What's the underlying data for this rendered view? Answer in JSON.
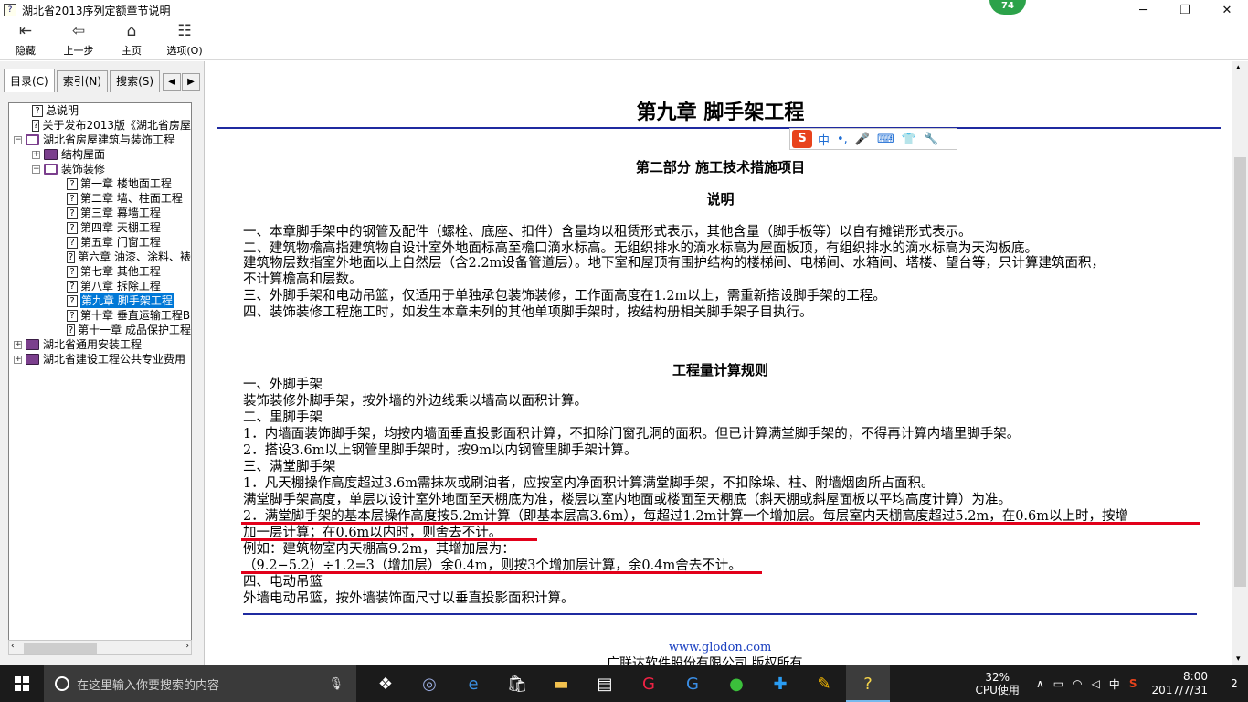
{
  "window": {
    "title": "湖北省2013序列定额章节说明",
    "controls": {
      "minimize": "─",
      "maximize": "❐",
      "close": "✕"
    },
    "badge": "74"
  },
  "toolbar": {
    "hide": "隐藏",
    "back": "上一步",
    "home": "主页",
    "options": "选项(O)"
  },
  "nav_tabs": {
    "contents": "目录(C)",
    "index": "索引(N)",
    "search": "搜索(S)"
  },
  "tree": [
    {
      "label": "总说明",
      "type": "doc",
      "level": 1
    },
    {
      "label": "关于发布2013版《湖北省房屋",
      "type": "doc",
      "level": 1
    },
    {
      "label": "湖北省房屋建筑与装饰工程",
      "type": "book-open",
      "level": 0,
      "expander": "−"
    },
    {
      "label": "结构屋面",
      "type": "book",
      "level": 1,
      "expander": "+"
    },
    {
      "label": "装饰装修",
      "type": "book-open",
      "level": 1,
      "expander": "−"
    },
    {
      "label": "第一章 楼地面工程",
      "type": "doc",
      "level": 2
    },
    {
      "label": "第二章 墙、柱面工程",
      "type": "doc",
      "level": 2
    },
    {
      "label": "第三章 幕墙工程",
      "type": "doc",
      "level": 2
    },
    {
      "label": "第四章 天棚工程",
      "type": "doc",
      "level": 2
    },
    {
      "label": "第五章 门窗工程",
      "type": "doc",
      "level": 2
    },
    {
      "label": "第六章 油漆、涂料、裱",
      "type": "doc",
      "level": 2
    },
    {
      "label": "第七章 其他工程",
      "type": "doc",
      "level": 2
    },
    {
      "label": "第八章 拆除工程",
      "type": "doc",
      "level": 2
    },
    {
      "label": "第九章 脚手架工程",
      "type": "doc",
      "level": 2,
      "selected": true
    },
    {
      "label": "第十章 垂直运输工程B",
      "type": "doc",
      "level": 2
    },
    {
      "label": "第十一章 成品保护工程",
      "type": "doc",
      "level": 2
    },
    {
      "label": "湖北省通用安装工程",
      "type": "book",
      "level": 0,
      "expander": "+"
    },
    {
      "label": "湖北省建设工程公共专业费用",
      "type": "book",
      "level": 0,
      "expander": "+"
    }
  ],
  "document": {
    "chapter_title": "第九章  脚手架工程",
    "part_title": "第二部分  施工技术措施项目",
    "notes_title": "说明",
    "notes": [
      "一、本章脚手架中的钢管及配件（螺栓、底座、扣件）含量均以租赁形式表示，其他含量（脚手板等）以自有摊销形式表示。",
      "二、建筑物檐高指建筑物自设计室外地面标高至檐口滴水标高。无组织排水的滴水标高为屋面板顶，有组织排水的滴水标高为天沟板底。",
      "建筑物层数指室外地面以上自然层（含2.2m设备管道层）。地下室和屋顶有围护结构的楼梯间、电梯间、水箱间、塔楼、望台等，只计算建筑面积，",
      "不计算檐高和层数。",
      "三、外脚手架和电动吊篮，仅适用于单独承包装饰装修，工作面高度在1.2m以上，需重新搭设脚手架的工程。",
      "四、装饰装修工程施工时，如发生本章未列的其他单项脚手架时，按结构册相关脚手架子目执行。"
    ],
    "rules_title": "工程量计算规则",
    "rules": [
      "一、外脚手架",
      "装饰装修外脚手架，按外墙的外边线乘以墙高以面积计算。",
      "二、里脚手架",
      "1．内墙面装饰脚手架，均按内墙面垂直投影面积计算，不扣除门窗孔洞的面积。但已计算满堂脚手架的，不得再计算内墙里脚手架。",
      "2．搭设3.6m以上钢管里脚手架时，按9m以内钢管里脚手架计算。",
      "三、满堂脚手架",
      "1．凡天棚操作高度超过3.6m需抹灰或刷油者，应按室内净面积计算满堂脚手架，不扣除垛、柱、附墙烟囱所占面积。",
      "满堂脚手架高度，单层以设计室外地面至天棚底为准，楼层以室内地面或楼面至天棚底（斜天棚或斜屋面板以平均高度计算）为准。",
      "2．满堂脚手架的基本层操作高度按5.2m计算（即基本层高3.6m），每超过1.2m计算一个增加层。每层室内天棚高度超过5.2m，在0.6m以上时，按增",
      "加一层计算；在0.6m以内时，则舍去不计。",
      "例如：建筑物室内天棚高9.2m，其增加层为：",
      "（9.2−5.2）÷1.2=3（增加层）余0.4m，则按3个增加层计算，余0.4m舍去不计。",
      "四、电动吊篮",
      "外墙电动吊篮，按外墙装饰面尺寸以垂直投影面积计算。"
    ],
    "footer_link": "www.glodon.com",
    "copyright": "广联达软件股份有限公司  版权所有"
  },
  "ime_bar": {
    "logo": "S",
    "mode": "中",
    "punct": "•,",
    "voice": "🎤",
    "keyboard": "⌨",
    "skin": "👕",
    "tools": "🔧"
  },
  "taskbar": {
    "search_placeholder": "在这里输入你要搜索的内容",
    "cpu_percent": "32%",
    "cpu_label": "CPU使用",
    "ime_indicator": "中",
    "time": "8:00",
    "date": "2017/7/31",
    "notifications": "2"
  },
  "colors": {
    "rule_blue": "#1f2aa0",
    "annotation_red": "#e2001a",
    "selection": "#0078d7"
  }
}
